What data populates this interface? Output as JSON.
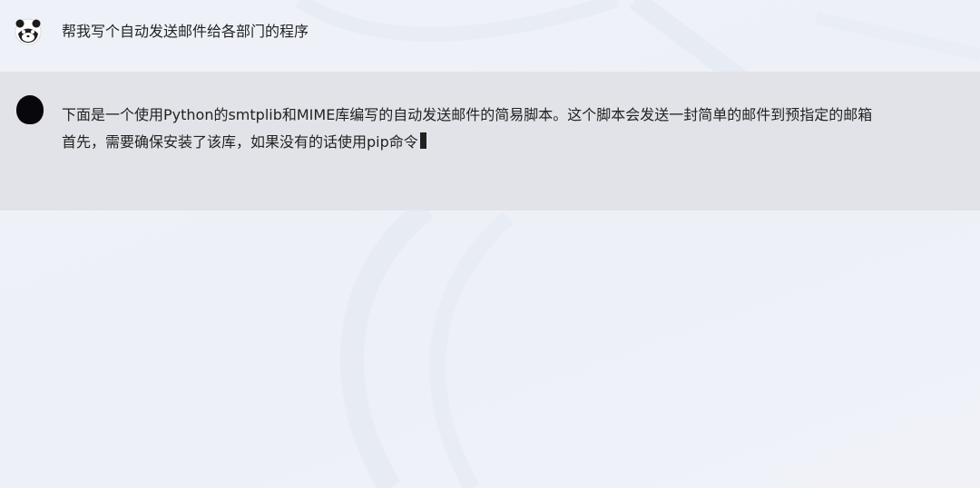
{
  "conversation": {
    "user_message": {
      "avatar_icon": "panda-avatar-icon",
      "text": "帮我写个自动发送邮件给各部门的程序"
    },
    "assistant_message": {
      "avatar_icon": "assistant-avatar-icon",
      "lines": [
        "下面是一个使用Python的smtplib和MIME库编写的自动发送邮件的简易脚本。这个脚本会发送一封简单的邮件到预指定的邮箱",
        "首先，需要确保安装了该库，如果没有的话使用pip命令"
      ],
      "streaming": true
    }
  },
  "colors": {
    "background": "#eef1f7",
    "assistant_panel": "#e2e3e8",
    "text": "#222222"
  }
}
